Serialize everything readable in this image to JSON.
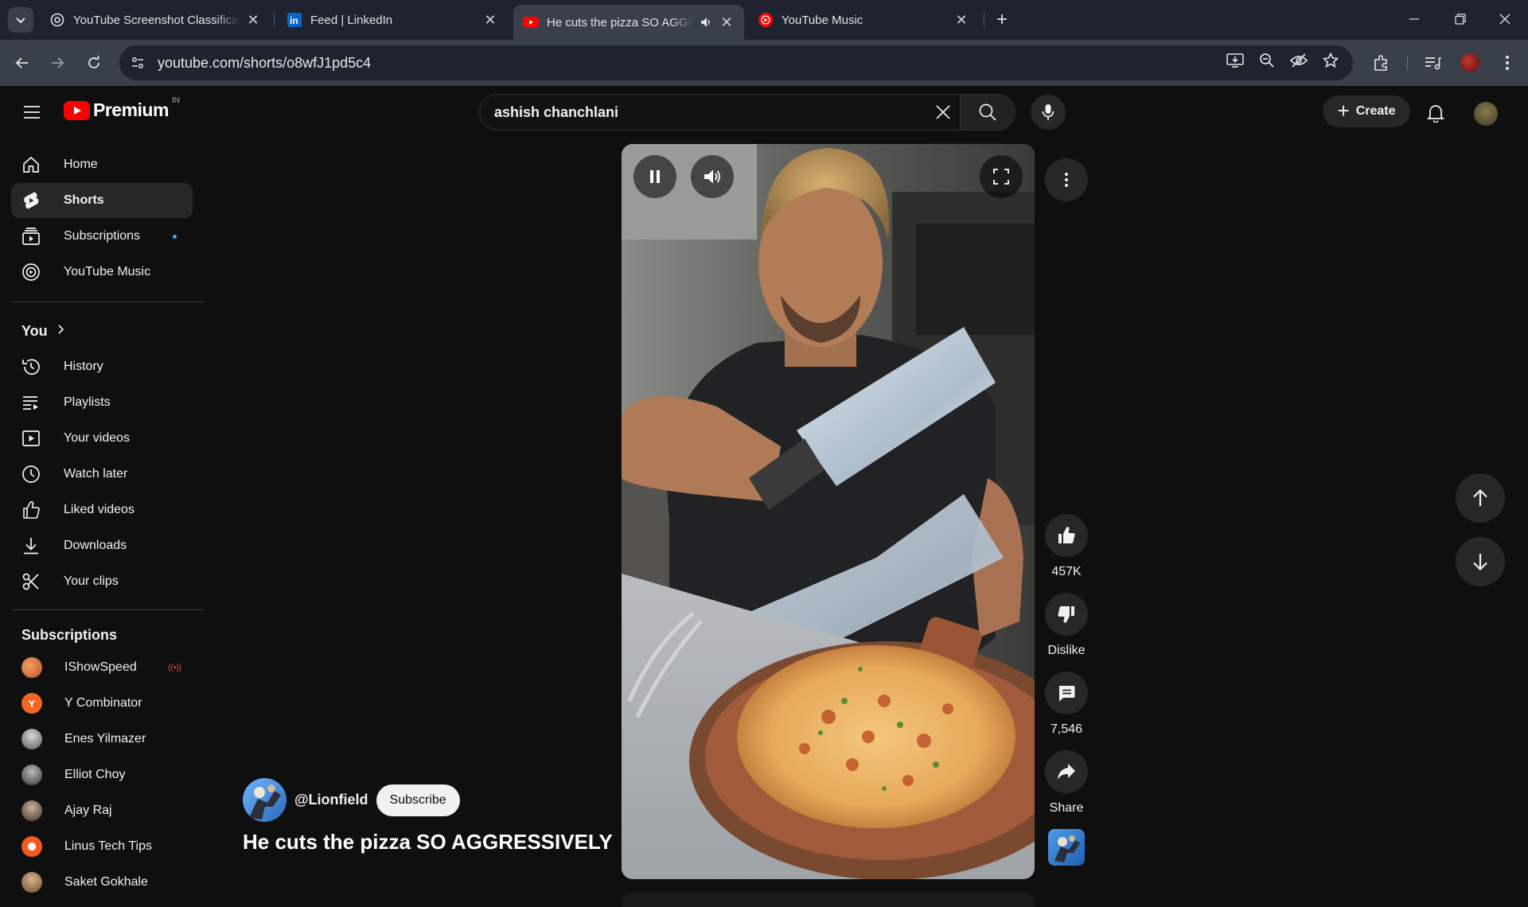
{
  "browser": {
    "tabs": [
      {
        "title": "YouTube Screenshot Classificati",
        "favicon": "chatgpt-icon"
      },
      {
        "title": "Feed | LinkedIn",
        "favicon": "linkedin-icon"
      },
      {
        "title": "He cuts the pizza SO AGGRESSIVELY",
        "favicon": "youtube-icon",
        "active": true,
        "audio": true
      },
      {
        "title": "YouTube Music",
        "favicon": "youtube-music-icon"
      }
    ],
    "url": "youtube.com/shorts/o8wfJ1pd5c4"
  },
  "masthead": {
    "brand": "Premium",
    "country_code": "IN",
    "search_value": "ashish chanchlani",
    "create_label": "Create"
  },
  "sidebar": {
    "main": [
      {
        "label": "Home",
        "icon": "home-icon"
      },
      {
        "label": "Shorts",
        "icon": "shorts-icon",
        "active": true
      },
      {
        "label": "Subscriptions",
        "icon": "subscriptions-icon",
        "badge": "new"
      },
      {
        "label": "YouTube Music",
        "icon": "youtube-music-icon"
      }
    ],
    "you_heading": "You",
    "you_items": [
      {
        "label": "History",
        "icon": "history-icon"
      },
      {
        "label": "Playlists",
        "icon": "playlists-icon"
      },
      {
        "label": "Your videos",
        "icon": "your-videos-icon"
      },
      {
        "label": "Watch later",
        "icon": "watch-later-icon"
      },
      {
        "label": "Liked videos",
        "icon": "liked-videos-icon"
      },
      {
        "label": "Downloads",
        "icon": "downloads-icon"
      },
      {
        "label": "Your clips",
        "icon": "clips-icon"
      }
    ],
    "subs_heading": "Subscriptions",
    "subscriptions": [
      {
        "name": "IShowSpeed",
        "color": "#e8743b",
        "live": true
      },
      {
        "name": "Y Combinator",
        "color": "#f26522"
      },
      {
        "name": "Enes Yilmazer",
        "color": "#8a8a8a"
      },
      {
        "name": "Elliot Choy",
        "color": "#6b6b6b"
      },
      {
        "name": "Ajay Raj",
        "color": "#7a6a5a"
      },
      {
        "name": "Linus Tech Tips",
        "color": "#f25a1f"
      },
      {
        "name": "Saket Gokhale",
        "color": "#9b7b5b"
      }
    ]
  },
  "short": {
    "channel_handle": "@Lionfield",
    "subscribe_label": "Subscribe",
    "title": "He cuts the pizza SO AGGRESSIVELY",
    "likes": "457K",
    "dislike_label": "Dislike",
    "comments": "7,546",
    "share_label": "Share"
  },
  "colors": {
    "accent": "#ff0000",
    "background": "#0f0f0f",
    "chrome_dark": "#1f2330",
    "chrome_light": "#3a3f4c"
  }
}
